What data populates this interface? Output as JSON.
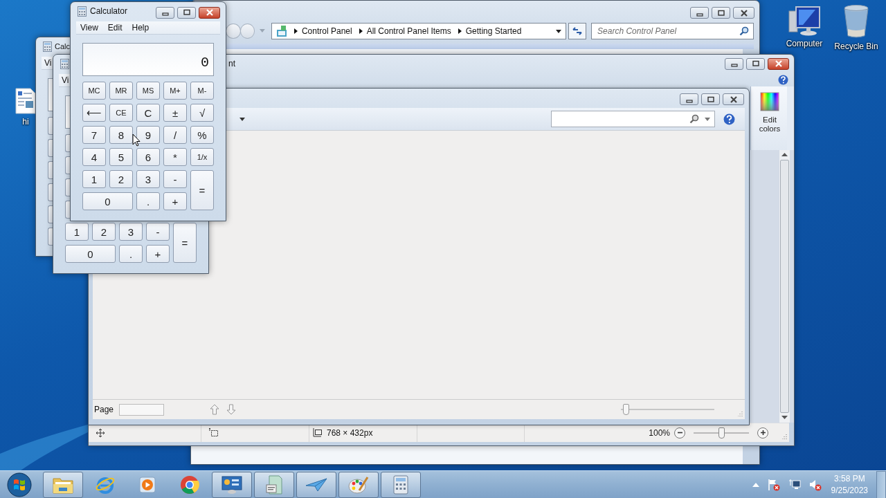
{
  "control_panel": {
    "breadcrumbs": [
      "Control Panel",
      "All Control Panel Items",
      "Getting Started"
    ],
    "search": {
      "placeholder": "Search Control Panel"
    }
  },
  "paint": {
    "title": "nt",
    "edit_colors": "Edit colors",
    "status": {
      "image_size": "768 × 432px",
      "zoom": "100%",
      "zoom_slider": {
        "level": 0.5
      }
    }
  },
  "viewer": {
    "page_label": "Page",
    "page_slider": {
      "level": 0.02
    }
  },
  "calculator_behind_1": {
    "title": "Calc",
    "menu": [
      "Vi"
    ]
  },
  "calculator_behind_2": {
    "menu": [
      "Vi"
    ],
    "keys": [
      {
        "label": "1",
        "kind": "normal"
      },
      {
        "label": "2",
        "kind": "normal"
      },
      {
        "label": "3",
        "kind": "normal"
      },
      {
        "label": "-",
        "kind": "normal"
      },
      {
        "label": "=",
        "kind": "tall"
      },
      {
        "label": "0",
        "kind": "wide"
      },
      {
        "label": ".",
        "kind": "normal"
      },
      {
        "label": "+",
        "kind": "normal"
      }
    ]
  },
  "calculator": {
    "title": "Calculator",
    "menu": [
      "View",
      "Edit",
      "Help"
    ],
    "display": "0",
    "keys": [
      {
        "label": "MC",
        "kind": "normal"
      },
      {
        "label": "MR",
        "kind": "normal"
      },
      {
        "label": "MS",
        "kind": "normal"
      },
      {
        "label": "M+",
        "kind": "normal"
      },
      {
        "label": "M-",
        "kind": "normal"
      },
      {
        "label": "⟵",
        "kind": "normal"
      },
      {
        "label": "CE",
        "kind": "normal"
      },
      {
        "label": "C",
        "kind": "normal"
      },
      {
        "label": "±",
        "kind": "normal"
      },
      {
        "label": "√",
        "kind": "normal"
      },
      {
        "label": "7",
        "kind": "normal"
      },
      {
        "label": "8",
        "kind": "normal"
      },
      {
        "label": "9",
        "kind": "normal"
      },
      {
        "label": "/",
        "kind": "normal"
      },
      {
        "label": "%",
        "kind": "normal"
      },
      {
        "label": "4",
        "kind": "normal"
      },
      {
        "label": "5",
        "kind": "normal"
      },
      {
        "label": "6",
        "kind": "normal"
      },
      {
        "label": "*",
        "kind": "normal"
      },
      {
        "label": "1/x",
        "kind": "normal"
      },
      {
        "label": "1",
        "kind": "normal"
      },
      {
        "label": "2",
        "kind": "normal"
      },
      {
        "label": "3",
        "kind": "normal"
      },
      {
        "label": "-",
        "kind": "normal"
      },
      {
        "label": "=",
        "kind": "tall"
      },
      {
        "label": "0",
        "kind": "wide"
      },
      {
        "label": ".",
        "kind": "normal"
      },
      {
        "label": "+",
        "kind": "normal"
      }
    ]
  },
  "desktop_icons": [
    {
      "kind": "document",
      "label": "hi"
    },
    {
      "kind": "computer",
      "label": "Computer"
    },
    {
      "kind": "recycle-bin",
      "label": "Recycle Bin"
    }
  ],
  "taskbar": {
    "items": [
      {
        "kind": "folder",
        "running": true
      },
      {
        "kind": "browser",
        "running": false
      },
      {
        "kind": "media-player",
        "running": false
      },
      {
        "kind": "chrome",
        "running": false
      },
      {
        "kind": "control-panel",
        "running": true
      },
      {
        "kind": "document",
        "running": true
      },
      {
        "kind": "plane",
        "running": true
      },
      {
        "kind": "paint",
        "running": true
      },
      {
        "kind": "calculator",
        "running": true
      }
    ],
    "time": "3:58 PM",
    "date": "9/25/2023"
  }
}
